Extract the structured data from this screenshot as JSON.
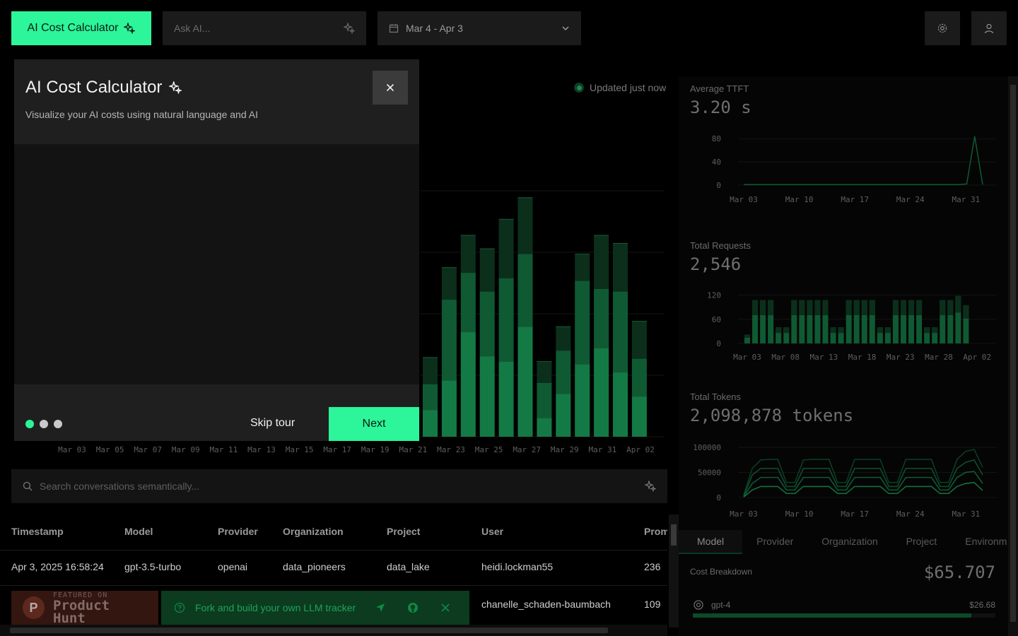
{
  "header": {
    "calc_button": "AI Cost Calculator",
    "ask_placeholder": "Ask AI...",
    "date_range": "Mar 4 - Apr 3"
  },
  "status": {
    "updated": "Updated just now"
  },
  "modal": {
    "title": "AI Cost Calculator",
    "subtitle": "Visualize your AI costs using natural language and AI",
    "skip": "Skip tour",
    "next": "Next",
    "steps": 3,
    "current_step": 1
  },
  "search": {
    "placeholder": "Search conversations semantically..."
  },
  "table": {
    "columns": [
      "Timestamp",
      "Model",
      "Provider",
      "Organization",
      "Project",
      "User",
      "Prom"
    ],
    "rows": [
      [
        "Apr 3, 2025 16:58:24",
        "gpt-3.5-turbo",
        "openai",
        "data_pioneers",
        "data_lake",
        "heidi.lockman55",
        "236"
      ],
      [
        "",
        "",
        "",
        "",
        "",
        "chanelle_schaden-baumbach",
        "109"
      ]
    ]
  },
  "banners": {
    "ph_small": "FEATURED ON",
    "ph_big": "Product Hunt",
    "fork_text": "Fork and build your own LLM tracker"
  },
  "right": {
    "ttft_label": "Average TTFT",
    "ttft_value": "3.20 s",
    "req_label": "Total Requests",
    "req_value": "2,546",
    "tok_label": "Total Tokens",
    "tok_value": "2,098,878 tokens",
    "tabs": [
      "Model",
      "Provider",
      "Organization",
      "Project",
      "Environm"
    ],
    "cost_label": "Cost Breakdown",
    "cost_value": "$65.707",
    "models": [
      {
        "name": "gpt-4",
        "price": "$26.68",
        "share": 0.92
      }
    ]
  },
  "colors": {
    "accent": "#2cf59a",
    "bar_dark": "#0b2f1b",
    "bar_mid": "#0f5a33",
    "bar_light": "#147a45"
  },
  "chart_data": [
    {
      "type": "bar",
      "title": "",
      "x_tick_labels": [
        "Mar 03",
        "Mar 05",
        "Mar 07",
        "Mar 09",
        "Mar 11",
        "Mar 13",
        "Mar 15",
        "Mar 17",
        "Mar 19",
        "Mar 21",
        "Mar 23",
        "Mar 25",
        "Mar 27",
        "Mar 29",
        "Mar 31",
        "Apr 02"
      ],
      "visible_values": [
        [
          1.0,
          0.95,
          1.0
        ],
        [
          2.1,
          3.0,
          1.2
        ],
        [
          3.9,
          2.2,
          1.4
        ],
        [
          3.0,
          2.4,
          1.6
        ],
        [
          2.8,
          3.1,
          2.2
        ],
        [
          4.1,
          2.7,
          2.1
        ],
        [
          0.7,
          1.3,
          0.8
        ],
        [
          1.6,
          1.6,
          0.9
        ],
        [
          2.7,
          3.1,
          1.0
        ],
        [
          3.3,
          2.2,
          2.0
        ],
        [
          2.4,
          3.0,
          1.8
        ],
        [
          1.5,
          1.4,
          1.4
        ]
      ]
    },
    {
      "type": "line",
      "title": "Average TTFT",
      "x_tick_labels": [
        "Mar 03",
        "Mar 10",
        "Mar 17",
        "Mar 24",
        "Mar 31"
      ],
      "y_ticks": [
        0,
        40,
        80
      ],
      "ylim": [
        0,
        90
      ],
      "values": [
        1,
        1,
        1,
        1,
        1,
        1,
        1,
        1,
        1,
        1,
        1,
        1,
        1,
        1,
        1,
        1,
        1,
        1,
        1,
        1,
        1,
        1,
        1,
        1,
        1,
        1,
        1,
        1,
        2,
        84,
        1
      ]
    },
    {
      "type": "bar",
      "title": "Total Requests",
      "x_tick_labels": [
        "Mar 03",
        "Mar 08",
        "Mar 13",
        "Mar 18",
        "Mar 23",
        "Mar 28",
        "Apr 02"
      ],
      "y_ticks": [
        0,
        60,
        120
      ],
      "ylim": [
        0,
        130
      ],
      "values": [
        22,
        108,
        108,
        108,
        40,
        40,
        108,
        108,
        108,
        108,
        108,
        40,
        40,
        108,
        108,
        108,
        108,
        40,
        40,
        108,
        108,
        108,
        108,
        40,
        40,
        108,
        108,
        118,
        95
      ]
    },
    {
      "type": "line",
      "title": "Total Tokens",
      "x_tick_labels": [
        "Mar 03",
        "Mar 10",
        "Mar 17",
        "Mar 24",
        "Mar 31"
      ],
      "y_ticks": [
        0,
        50000,
        100000
      ],
      "ylim": [
        0,
        110000
      ],
      "series": [
        {
          "values": [
            5000,
            58000,
            75000,
            76000,
            76000,
            30000,
            30000,
            75000,
            76000,
            76000,
            76000,
            30000,
            30000,
            76000,
            76000,
            76000,
            76000,
            30000,
            30000,
            76000,
            76000,
            76000,
            76000,
            30000,
            30000,
            76000,
            92000,
            96000,
            60000
          ]
        },
        {
          "values": [
            3000,
            45000,
            58000,
            58000,
            58000,
            22000,
            22000,
            58000,
            58000,
            58000,
            58000,
            22000,
            22000,
            58000,
            58000,
            58000,
            58000,
            22000,
            22000,
            58000,
            58000,
            58000,
            58000,
            22000,
            22000,
            58000,
            70000,
            75000,
            45000
          ]
        },
        {
          "values": [
            2000,
            28000,
            40000,
            40000,
            40000,
            15000,
            15000,
            40000,
            40000,
            40000,
            40000,
            15000,
            15000,
            40000,
            40000,
            40000,
            40000,
            15000,
            15000,
            40000,
            40000,
            40000,
            40000,
            15000,
            15000,
            40000,
            50000,
            52000,
            28000
          ]
        },
        {
          "values": [
            1000,
            15000,
            22000,
            22000,
            22000,
            8000,
            8000,
            22000,
            22000,
            22000,
            22000,
            8000,
            8000,
            22000,
            22000,
            22000,
            22000,
            8000,
            8000,
            22000,
            22000,
            22000,
            22000,
            8000,
            8000,
            22000,
            28000,
            30000,
            14000
          ]
        }
      ]
    }
  ]
}
